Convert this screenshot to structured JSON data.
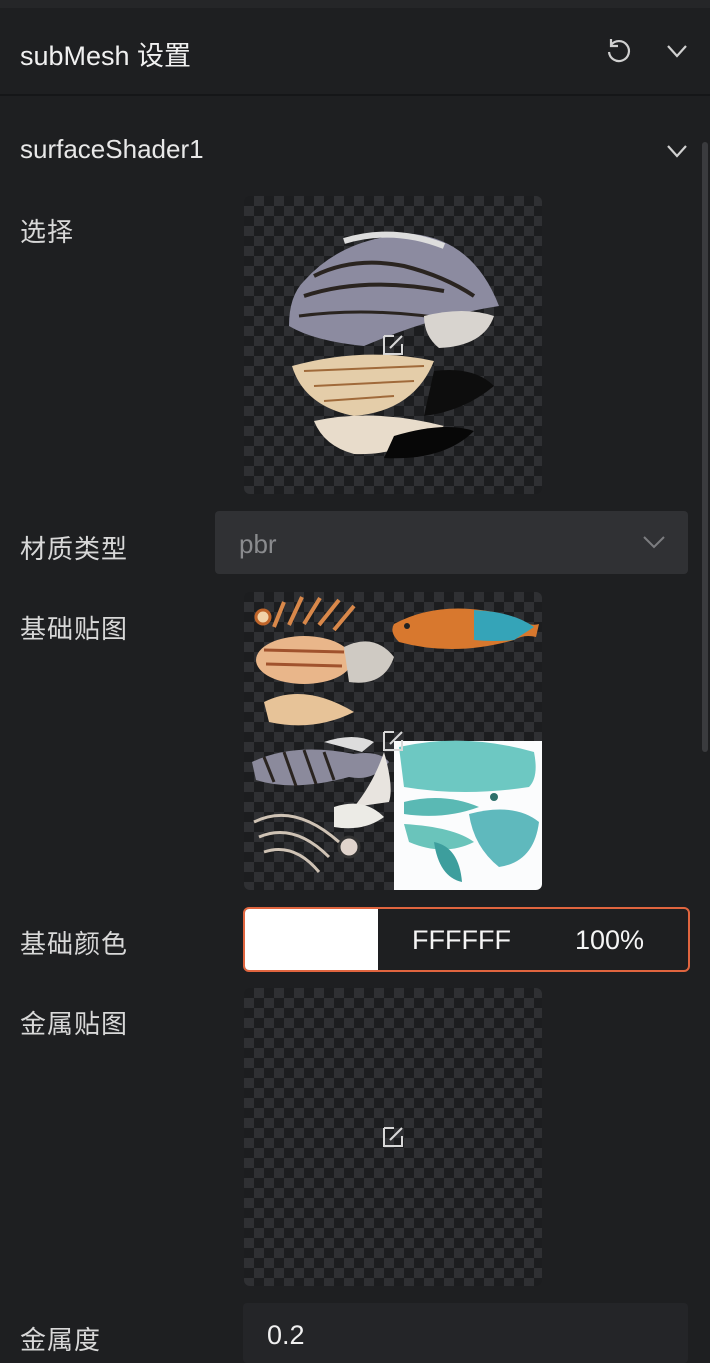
{
  "header": {
    "title": "subMesh 设置",
    "reset_icon": "reset-icon",
    "collapse_icon": "chevron-down-icon"
  },
  "section": {
    "title": "surfaceShader1",
    "chevron_icon": "chevron-down-icon"
  },
  "fields": {
    "select_label": "选择",
    "material_type_label": "材质类型",
    "material_type_value": "pbr",
    "base_map_label": "基础贴图",
    "base_color_label": "基础颜色",
    "base_color_hex": "FFFFFF",
    "base_color_alpha": "100%",
    "base_color_swatch": "#ffffff",
    "metal_map_label": "金属贴图",
    "metalness_label": "金属度",
    "metalness_value": "0.2"
  },
  "colors": {
    "accent_border": "#e0653f",
    "background": "#1e1f21",
    "input_bg": "#303134"
  }
}
